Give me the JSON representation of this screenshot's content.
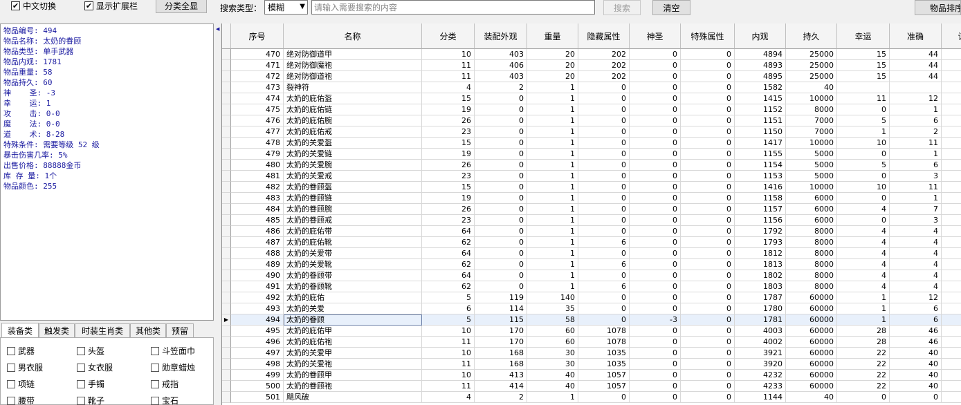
{
  "toolbar": {
    "chinese_toggle": {
      "label": "中文切换",
      "checked": true
    },
    "show_ext": {
      "label": "显示扩展栏",
      "checked": true
    },
    "show_all_button": "分类全显",
    "search_type_label": "搜索类型：",
    "search_type_value": "模糊",
    "search_placeholder": "请输入需要搜索的内容",
    "search_button": "搜索",
    "clear_button": "清空",
    "rank_button": "物品排序"
  },
  "info": {
    "lines": [
      "物品编号: 494",
      "物品名称: 太奶的眷顾",
      "物品类型: 单手武器",
      "物品内观: 1781",
      "物品重量: 58",
      "物品持久: 60",
      "神    圣: -3",
      "幸    运: 1",
      "攻    击: 0-0",
      "魔    法: 0-0",
      "道    术: 8-28",
      "特殊条件: 需要等级 52 级",
      "暴击伤害几率: 5%",
      "出售价格: 88888金币",
      "库 存 量: 1个",
      "物品颜色: 255"
    ]
  },
  "tabs": [
    "装备类",
    "触发类",
    "时装生肖类",
    "其他类",
    "预留"
  ],
  "categories": [
    "武器",
    "头盔",
    "斗笠面巾",
    "男衣服",
    "女衣服",
    "勋章蜡烛",
    "项链",
    "手镯",
    "戒指",
    "腰带",
    "靴子",
    "宝石"
  ],
  "grid": {
    "columns": [
      "序号",
      "名称",
      "分类",
      "装配外观",
      "重量",
      "隐藏属性",
      "神圣",
      "特殊属性",
      "内观",
      "持久",
      "幸运",
      "准确",
      "诅"
    ],
    "selected_row": 24,
    "rows": [
      [
        "470",
        "绝对防御道甲",
        "10",
        "403",
        "20",
        "202",
        "0",
        "0",
        "4894",
        "25000",
        "15",
        "44"
      ],
      [
        "471",
        "绝对防御魔袍",
        "11",
        "406",
        "20",
        "202",
        "0",
        "0",
        "4893",
        "25000",
        "15",
        "44"
      ],
      [
        "472",
        "绝对防御道袍",
        "11",
        "403",
        "20",
        "202",
        "0",
        "0",
        "4895",
        "25000",
        "15",
        "44"
      ],
      [
        "473",
        "裂神符",
        "4",
        "2",
        "1",
        "0",
        "0",
        "0",
        "1582",
        "40",
        "",
        ""
      ],
      [
        "474",
        "太奶的庇佑盔",
        "15",
        "0",
        "1",
        "0",
        "0",
        "0",
        "1415",
        "10000",
        "11",
        "12"
      ],
      [
        "475",
        "太奶的庇佑链",
        "19",
        "0",
        "1",
        "0",
        "0",
        "0",
        "1152",
        "8000",
        "0",
        "1"
      ],
      [
        "476",
        "太奶的庇佑腕",
        "26",
        "0",
        "1",
        "0",
        "0",
        "0",
        "1151",
        "7000",
        "5",
        "6"
      ],
      [
        "477",
        "太奶的庇佑戒",
        "23",
        "0",
        "1",
        "0",
        "0",
        "0",
        "1150",
        "7000",
        "1",
        "2"
      ],
      [
        "478",
        "太奶的关爱盔",
        "15",
        "0",
        "1",
        "0",
        "0",
        "0",
        "1417",
        "10000",
        "10",
        "11"
      ],
      [
        "479",
        "太奶的关爱链",
        "19",
        "0",
        "1",
        "0",
        "0",
        "0",
        "1155",
        "5000",
        "0",
        "1"
      ],
      [
        "480",
        "太奶的关爱腕",
        "26",
        "0",
        "1",
        "0",
        "0",
        "0",
        "1154",
        "5000",
        "5",
        "6"
      ],
      [
        "481",
        "太奶的关爱戒",
        "23",
        "0",
        "1",
        "0",
        "0",
        "0",
        "1153",
        "5000",
        "0",
        "3"
      ],
      [
        "482",
        "太奶的眷顾盔",
        "15",
        "0",
        "1",
        "0",
        "0",
        "0",
        "1416",
        "10000",
        "10",
        "11"
      ],
      [
        "483",
        "太奶的眷顾链",
        "19",
        "0",
        "1",
        "0",
        "0",
        "0",
        "1158",
        "6000",
        "0",
        "1"
      ],
      [
        "484",
        "太奶的眷顾腕",
        "26",
        "0",
        "1",
        "0",
        "0",
        "0",
        "1157",
        "6000",
        "4",
        "7"
      ],
      [
        "485",
        "太奶的眷顾戒",
        "23",
        "0",
        "1",
        "0",
        "0",
        "0",
        "1156",
        "6000",
        "0",
        "3"
      ],
      [
        "486",
        "太奶的庇佑带",
        "64",
        "0",
        "1",
        "0",
        "0",
        "0",
        "1792",
        "8000",
        "4",
        "4"
      ],
      [
        "487",
        "太奶的庇佑靴",
        "62",
        "0",
        "1",
        "6",
        "0",
        "0",
        "1793",
        "8000",
        "4",
        "4"
      ],
      [
        "488",
        "太奶的关爱带",
        "64",
        "0",
        "1",
        "0",
        "0",
        "0",
        "1812",
        "8000",
        "4",
        "4"
      ],
      [
        "489",
        "太奶的关爱靴",
        "62",
        "0",
        "1",
        "6",
        "0",
        "0",
        "1813",
        "8000",
        "4",
        "4"
      ],
      [
        "490",
        "太奶的眷顾带",
        "64",
        "0",
        "1",
        "0",
        "0",
        "0",
        "1802",
        "8000",
        "4",
        "4"
      ],
      [
        "491",
        "太奶的眷顾靴",
        "62",
        "0",
        "1",
        "6",
        "0",
        "0",
        "1803",
        "8000",
        "4",
        "4"
      ],
      [
        "492",
        "太奶的庇佑",
        "5",
        "119",
        "140",
        "0",
        "0",
        "0",
        "1787",
        "60000",
        "1",
        "12"
      ],
      [
        "493",
        "太奶的关爱",
        "6",
        "114",
        "35",
        "0",
        "0",
        "0",
        "1780",
        "60000",
        "1",
        "6"
      ],
      [
        "494",
        "太奶的眷顾",
        "5",
        "115",
        "58",
        "0",
        "-3",
        "0",
        "1781",
        "60000",
        "1",
        "6"
      ],
      [
        "495",
        "太奶的庇佑甲",
        "10",
        "170",
        "60",
        "1078",
        "0",
        "0",
        "4003",
        "60000",
        "28",
        "46"
      ],
      [
        "496",
        "太奶的庇佑袍",
        "11",
        "170",
        "60",
        "1078",
        "0",
        "0",
        "4002",
        "60000",
        "28",
        "46"
      ],
      [
        "497",
        "太奶的关爱甲",
        "10",
        "168",
        "30",
        "1035",
        "0",
        "0",
        "3921",
        "60000",
        "22",
        "40"
      ],
      [
        "498",
        "太奶的关爱袍",
        "11",
        "168",
        "30",
        "1035",
        "0",
        "0",
        "3920",
        "60000",
        "22",
        "40"
      ],
      [
        "499",
        "太奶的眷顾甲",
        "10",
        "413",
        "40",
        "1057",
        "0",
        "0",
        "4232",
        "60000",
        "22",
        "40"
      ],
      [
        "500",
        "太奶的眷顾袍",
        "11",
        "414",
        "40",
        "1057",
        "0",
        "0",
        "4233",
        "60000",
        "22",
        "40"
      ],
      [
        "501",
        "飓风破",
        "4",
        "2",
        "1",
        "0",
        "0",
        "0",
        "1144",
        "40",
        "0",
        "0"
      ]
    ]
  }
}
